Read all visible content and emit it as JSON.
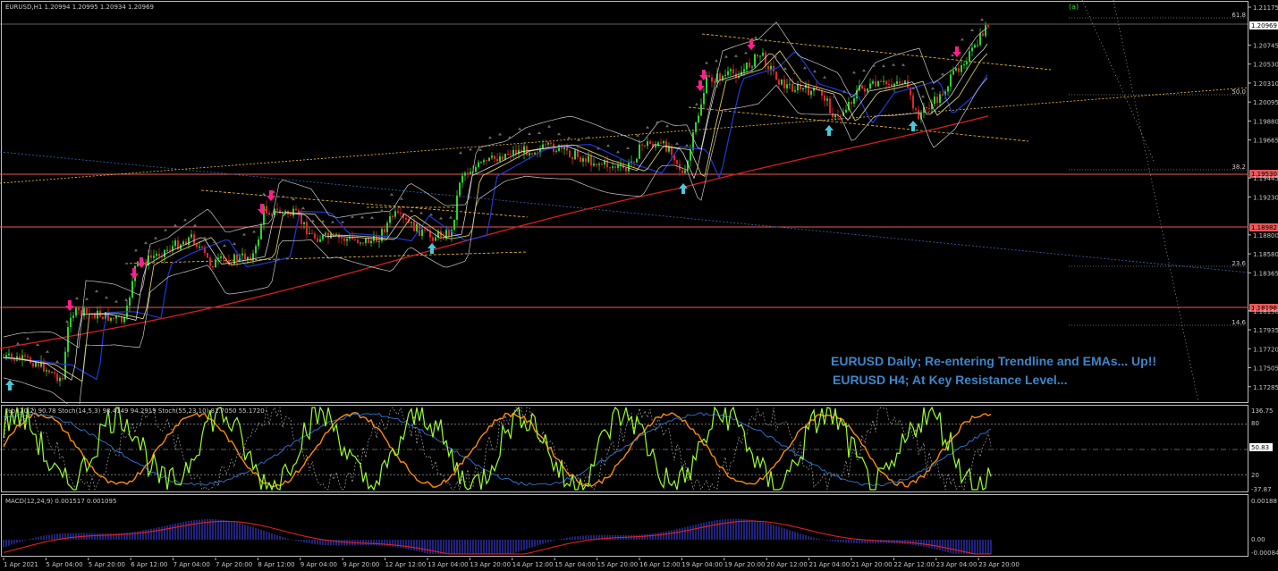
{
  "chart": {
    "header": "EURUSD,H1  1.20994 1.20995 1.20934 1.20969",
    "wave_label": "(a)",
    "price_labels": [
      "1.21175",
      "1.20969",
      "1.20745",
      "1.20530",
      "1.20310",
      "1.20095",
      "1.19880",
      "1.19665",
      "1.19530",
      "1.19445",
      "1.19230",
      "1.18982",
      "1.18800",
      "1.18580",
      "1.18365",
      "1.18196",
      "1.18150",
      "1.17935",
      "1.17720",
      "1.17505",
      "1.17285"
    ],
    "highlight_prices": {
      "current": "1.20969",
      "level1": "1.19530",
      "level2": "1.18982",
      "level3": "1.18196"
    },
    "fib_labels": [
      "61.8",
      "50.0",
      "38.2",
      "23.6",
      "14.6"
    ],
    "time_labels": [
      "1 Apr 2021",
      "5 Apr 04:00",
      "5 Apr 20:00",
      "6 Apr 12:00",
      "7 Apr 04:00",
      "7 Apr 20:00",
      "8 Apr 12:00",
      "9 Apr 04:00",
      "9 Apr 20:00",
      "12 Apr 12:00",
      "13 Apr 04:00",
      "13 Apr 20:00",
      "14 Apr 12:00",
      "15 Apr 04:00",
      "15 Apr 20:00",
      "16 Apr 12:00",
      "19 Apr 04:00",
      "19 Apr 20:00",
      "20 Apr 12:00",
      "21 Apr 04:00",
      "21 Apr 20:00",
      "22 Apr 12:00",
      "23 Apr 04:00",
      "23 Apr 20:00"
    ],
    "annotation_1": "EURUSD Daily; Re-entering Trendline and EMAs... Up!!",
    "annotation_2": "EURUSD H4; At Key Resistance Level...",
    "colors": {
      "bull": "#2fd32f",
      "bear": "#e0262a",
      "ema_long": "#d81e1e",
      "ema_mid": "#1f3ad6",
      "band": "#c8c8c8",
      "fib": "#f5c342",
      "level": "#e85a5a",
      "up_arrow": "#47c9d8",
      "down_arrow": "#ff1e8c",
      "annot": "#3f86c9"
    }
  },
  "oscillator": {
    "header": "%b (20,2) 90.78  Stoch(14,5,3) 98.4149 94.2919  Stoch(55,23,10) 81.7050 55.1720",
    "scale": [
      "136.75",
      "80",
      "50.83",
      "20",
      "-37.87"
    ]
  },
  "macd": {
    "header": "MACD(12,24,9) 0.001517 0.001095",
    "scale": [
      "0.00188",
      "0.00",
      "-0.00084"
    ]
  }
}
